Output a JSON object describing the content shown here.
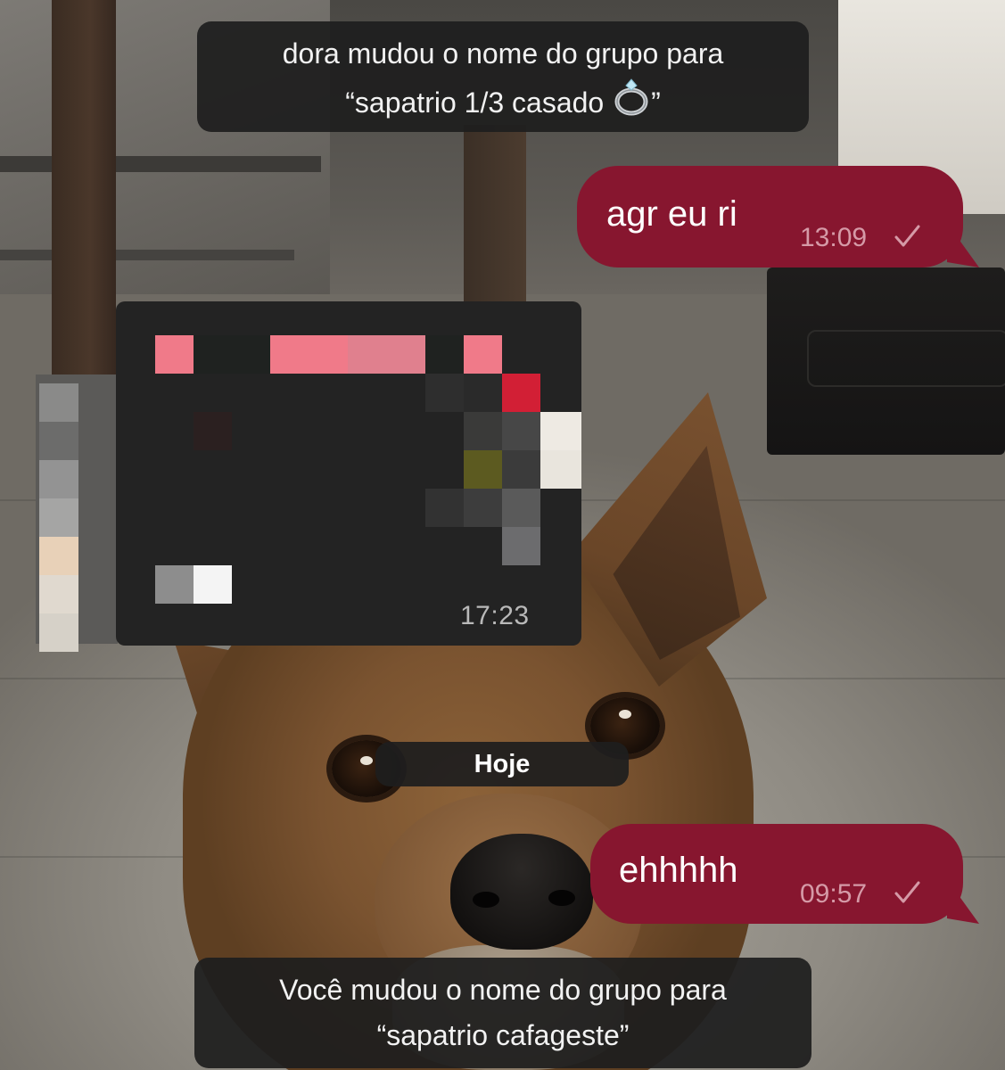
{
  "chat": {
    "system_top": {
      "line1": "dora mudou o nome do grupo para",
      "line2_prefix": "“sapatrio 1/3 casado ",
      "line2_suffix": "”",
      "emoji_icon": "ring-icon"
    },
    "msg_out_1": {
      "text": "agr eu ri",
      "time": "13:09",
      "status_icon": "check-icon"
    },
    "media_msg": {
      "time": "17:23",
      "censored": true
    },
    "date_separator": "Hoje",
    "msg_out_2": {
      "text": "ehhhhh",
      "time": "09:57",
      "status_icon": "check-icon"
    },
    "system_bottom": {
      "line1": "Você mudou o nome do grupo para",
      "line2": "“sapatrio cafageste”"
    }
  },
  "colors": {
    "outgoing_bubble": "#87162f",
    "system_bubble": "#1e1e1e",
    "time_outgoing": "#d59aa7"
  }
}
